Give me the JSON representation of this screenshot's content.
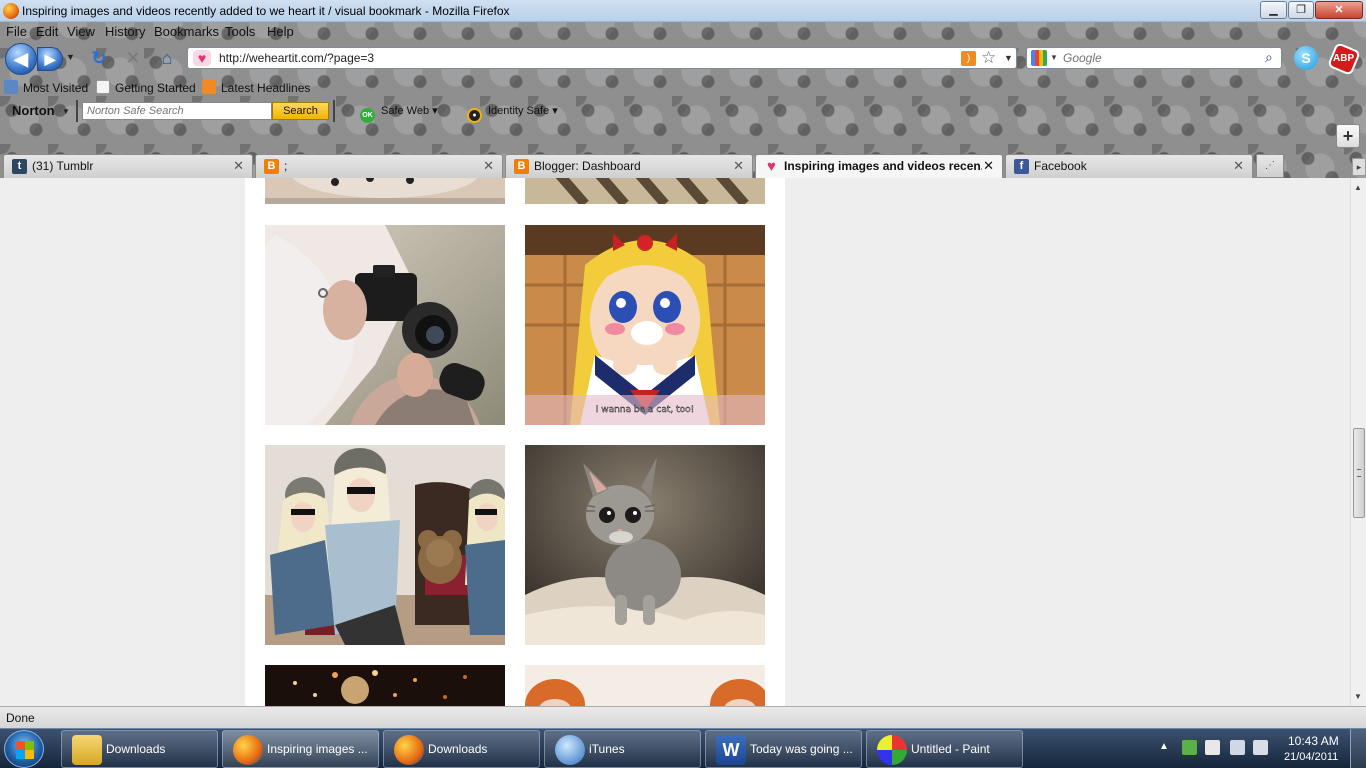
{
  "window": {
    "title": "Inspiring images and videos recently added to we heart it / visual bookmark - Mozilla Firefox",
    "min_icon": "minimize-icon",
    "max_icon": "maximize-icon",
    "close_icon": "close-icon"
  },
  "menu": {
    "items": [
      "File",
      "Edit",
      "View",
      "History",
      "Bookmarks",
      "Tools",
      "Help"
    ]
  },
  "nav": {
    "url": "http://weheartit.com/?page=3",
    "search_placeholder": "Google"
  },
  "bookmarks": {
    "items": [
      "Most Visited",
      "Getting Started",
      "Latest Headlines"
    ]
  },
  "norton": {
    "logo": "Norton",
    "search_placeholder": "Norton Safe Search",
    "search_button": "Search",
    "safe_web": "Safe Web",
    "identity_safe": "Identity Safe",
    "ok_badge": "OK"
  },
  "tabs": [
    {
      "label": "(31) Tumblr",
      "icon": "tumblr-icon",
      "color": "#2c4762"
    },
    {
      "label": ";",
      "icon": "blogger-icon",
      "color": "#f57d00"
    },
    {
      "label": "Blogger: Dashboard",
      "icon": "blogger-icon",
      "color": "#f57d00"
    },
    {
      "label": "Inspiring images and videos recen...",
      "icon": "heart-icon",
      "color": "#e0356a",
      "active": true
    },
    {
      "label": "Facebook",
      "icon": "facebook-icon",
      "color": "#3b5998"
    }
  ],
  "content": {
    "images": [
      {
        "subject": "girl with camera"
      },
      {
        "subject": "anime girl",
        "caption": "I wanna be a cat, too!"
      },
      {
        "subject": "three girls with teddy bear"
      },
      {
        "subject": "kitten"
      }
    ]
  },
  "status": {
    "text": "Done"
  },
  "taskbar": {
    "items": [
      {
        "label": "Downloads",
        "icon": "folder-icon"
      },
      {
        "label": "Inspiring images ...",
        "icon": "firefox-icon",
        "active": true
      },
      {
        "label": "Downloads",
        "icon": "firefox-icon"
      },
      {
        "label": "iTunes",
        "icon": "itunes-icon"
      },
      {
        "label": "Today was going ...",
        "icon": "word-icon"
      },
      {
        "label": "Untitled - Paint",
        "icon": "paint-icon"
      }
    ],
    "clock_time": "10:43 AM",
    "clock_date": "21/04/2011"
  },
  "colors": {
    "accent_blue": "#3a76c9",
    "heart_pink": "#e0356a",
    "norton_yellow": "#f1b400"
  }
}
